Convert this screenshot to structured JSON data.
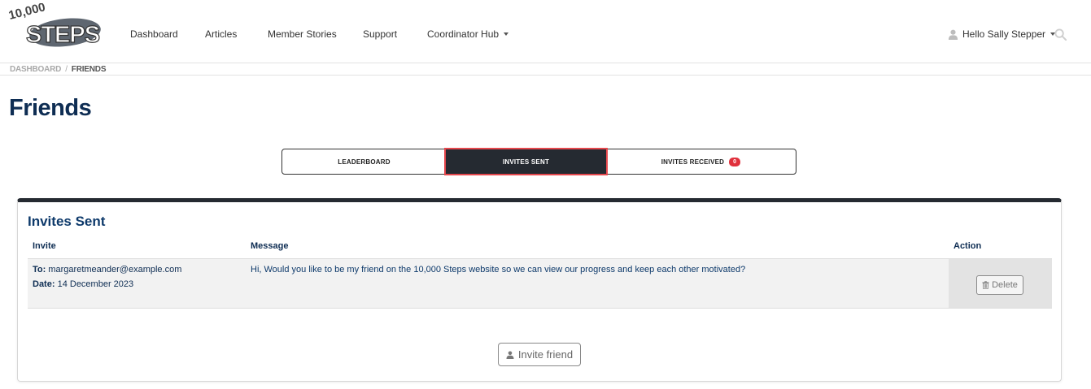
{
  "brand": {
    "logo_top": "10,000",
    "logo_main": "STEPS"
  },
  "nav": {
    "dashboard": "Dashboard",
    "articles": "Articles",
    "member_stories": "Member Stories",
    "support": "Support",
    "coordinator_hub": "Coordinator Hub"
  },
  "user": {
    "greeting": "Hello Sally Stepper"
  },
  "breadcrumb": {
    "home": "DASHBOARD",
    "separator": "/",
    "current": "FRIENDS"
  },
  "page": {
    "title": "Friends"
  },
  "tabs": {
    "leaderboard": "LEADERBOARD",
    "invites_sent": "INVITES SENT",
    "invites_received": "INVITES RECEIVED",
    "invites_received_count": "0",
    "active": "invites_sent"
  },
  "card": {
    "title": "Invites Sent",
    "columns": {
      "invite": "Invite",
      "message": "Message",
      "action": "Action"
    },
    "rows": [
      {
        "to_label": "To:",
        "to": "margaretmeander@example.com",
        "date_label": "Date:",
        "date": "14 December 2023",
        "message": "Hi, Would you like to be my friend on the 10,000 Steps website so we can view our progress and keep each other motivated?",
        "action": "Delete"
      }
    ],
    "invite_button": "Invite friend"
  },
  "colors": {
    "navy": "#0e2d53",
    "dark_tab": "#252a31",
    "highlight": "#e5484d",
    "badge": "#e0303c"
  },
  "icons": [
    "user-icon",
    "caret-down-icon",
    "search-icon",
    "trash-icon",
    "person-icon"
  ]
}
